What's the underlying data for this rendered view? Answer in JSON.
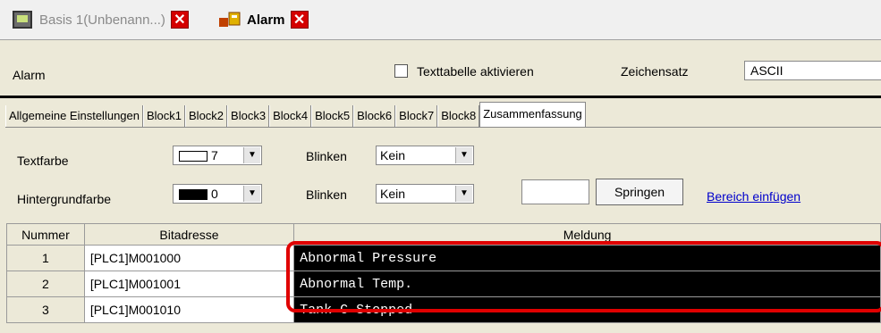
{
  "doc_tabs": [
    {
      "label": "Basis 1(Unbenann...)",
      "active": false
    },
    {
      "label": "Alarm",
      "active": true
    }
  ],
  "header": {
    "title": "Alarm",
    "checkbox_label": "Texttabelle aktivieren",
    "charset_label": "Zeichensatz",
    "charset_value": "ASCII"
  },
  "tabs": [
    "Allgemeine Einstellungen",
    "Block1",
    "Block2",
    "Block3",
    "Block4",
    "Block5",
    "Block6",
    "Block7",
    "Block8",
    "Zusammenfassung"
  ],
  "settings": {
    "text_color_label": "Textfarbe",
    "text_color_value": "7",
    "bg_color_label": "Hintergrundfarbe",
    "bg_color_value": "0",
    "blink_label": "Blinken",
    "blink1_value": "Kein",
    "blink2_value": "Kein",
    "jump_button": "Springen",
    "insert_link": "Bereich einfügen"
  },
  "table": {
    "headers": [
      "Nummer",
      "Bitadresse",
      "Meldung"
    ],
    "rows": [
      {
        "num": "1",
        "bit": "[PLC1]M001000",
        "msg": "Abnormal Pressure"
      },
      {
        "num": "2",
        "bit": "[PLC1]M001001",
        "msg": "Abnormal Temp."
      },
      {
        "num": "3",
        "bit": "[PLC1]M001010",
        "msg": "Tank C Stopped"
      }
    ]
  },
  "colors": {
    "highlight": "#e00000",
    "close": "#d40000",
    "link": "#0000cc"
  }
}
